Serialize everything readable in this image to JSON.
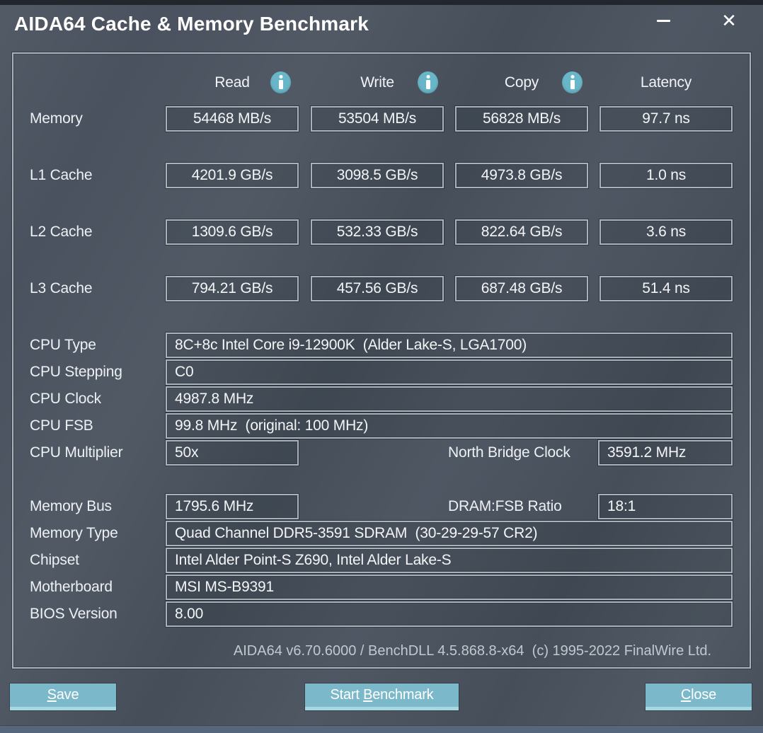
{
  "window": {
    "title": "AIDA64 Cache & Memory Benchmark",
    "close_glyph": "✕"
  },
  "icons": {
    "info": "letter-i-in-teal-circle",
    "minimize": "horizontal-dash",
    "close": "x-cross"
  },
  "columns": [
    {
      "label": "Read",
      "has_info_icon": true
    },
    {
      "label": "Write",
      "has_info_icon": true
    },
    {
      "label": "Copy",
      "has_info_icon": true
    },
    {
      "label": "Latency",
      "has_info_icon": false
    }
  ],
  "benchmark_rows": [
    {
      "label": "Memory",
      "read": "54468 MB/s",
      "write": "53504 MB/s",
      "copy": "56828 MB/s",
      "latency": "97.7 ns"
    },
    {
      "label": "L1 Cache",
      "read": "4201.9 GB/s",
      "write": "3098.5 GB/s",
      "copy": "4973.8 GB/s",
      "latency": "1.0 ns"
    },
    {
      "label": "L2 Cache",
      "read": "1309.6 GB/s",
      "write": "532.33 GB/s",
      "copy": "822.64 GB/s",
      "latency": "3.6 ns"
    },
    {
      "label": "L3 Cache",
      "read": "794.21 GB/s",
      "write": "457.56 GB/s",
      "copy": "687.48 GB/s",
      "latency": "51.4 ns"
    }
  ],
  "cpu": {
    "type": {
      "label": "CPU Type",
      "value": "8C+8c Intel Core i9-12900K  (Alder Lake-S, LGA1700)"
    },
    "stepping": {
      "label": "CPU Stepping",
      "value": "C0"
    },
    "clock": {
      "label": "CPU Clock",
      "value": "4987.8 MHz"
    },
    "fsb": {
      "label": "CPU FSB",
      "value": "99.8 MHz  (original: 100 MHz)"
    },
    "multiplier": {
      "label": "CPU Multiplier",
      "value": "50x"
    },
    "north_bridge": {
      "label": "North Bridge Clock",
      "value": "3591.2 MHz"
    }
  },
  "memory_info": {
    "bus": {
      "label": "Memory Bus",
      "value": "1795.6 MHz"
    },
    "dram_ratio": {
      "label": "DRAM:FSB Ratio",
      "value": "18:1"
    },
    "type": {
      "label": "Memory Type",
      "value": "Quad Channel DDR5-3591 SDRAM  (30-29-29-57 CR2)"
    },
    "chipset": {
      "label": "Chipset",
      "value": "Intel Alder Point-S Z690, Intel Alder Lake-S"
    },
    "motherboard": {
      "label": "Motherboard",
      "value": "MSI MS-B9391"
    },
    "bios": {
      "label": "BIOS Version",
      "value": "8.00"
    }
  },
  "footer": {
    "text": "AIDA64 v6.70.6000 / BenchDLL 4.5.868.8-x64  (c) 1995-2022 FinalWire Ltd."
  },
  "buttons": {
    "save": {
      "pre": "",
      "key": "S",
      "post": "ave"
    },
    "start": {
      "pre": "Start ",
      "key": "B",
      "post": "enchmark"
    },
    "close": {
      "pre": "",
      "key": "C",
      "post": "lose"
    }
  },
  "colors": {
    "window_bg": "#49525e",
    "box_border": "#a9b1bb",
    "accent_teal": "#68b6c8",
    "button_bg": "#7bb8c9",
    "button_bevel": "#a7d7e1",
    "bottom_strip": "#56677b",
    "footer_text": "#c1c8d0"
  }
}
